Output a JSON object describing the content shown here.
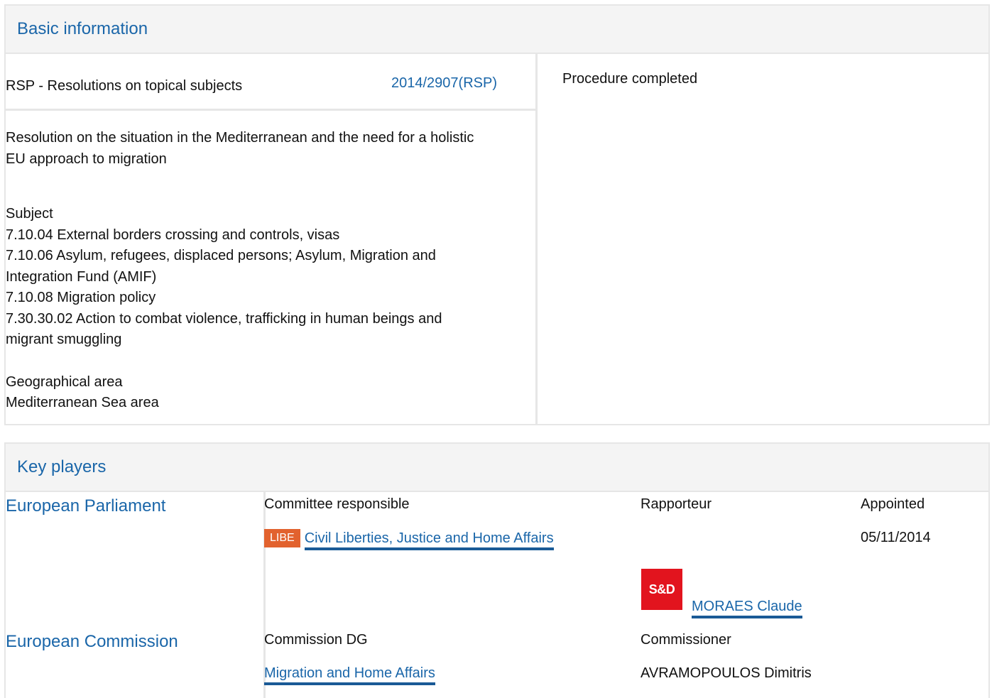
{
  "basic": {
    "heading": "Basic information",
    "procedure_type": "RSP - Resolutions on topical subjects",
    "procedure_ref": "2014/2907(RSP)",
    "status": "Procedure completed",
    "title_line1": "Resolution on the situation in the Mediterranean and the need for a holistic",
    "title_line2": "EU approach to migration",
    "subject_label": "Subject",
    "subjects": [
      "7.10.04 External borders crossing and controls, visas",
      "7.10.06 Asylum, refugees, displaced persons; Asylum, Migration and",
      "Integration Fund (AMIF)",
      "7.10.08 Migration policy",
      "7.30.30.02 Action to combat violence, trafficking in human beings and",
      "migrant smuggling"
    ],
    "geo_label": "Geographical area",
    "geo_value": "Mediterranean Sea area"
  },
  "players": {
    "heading": "Key players",
    "ep": {
      "name": "European Parliament",
      "col_committee": "Committee responsible",
      "col_rapporteur": "Rapporteur",
      "col_appointed": "Appointed",
      "committee_badge": "LIBE",
      "committee_name": "Civil Liberties, Justice and Home Affairs",
      "appointed_date": "05/11/2014",
      "group_logo": "S&D",
      "rapporteur_name": "MORAES Claude"
    },
    "ec": {
      "name": "European Commission",
      "col_dg": "Commission DG",
      "col_commissioner": "Commissioner",
      "dg_name": "Migration and Home Affairs",
      "commissioner_name": "AVRAMOPOULOS Dimitris"
    }
  }
}
